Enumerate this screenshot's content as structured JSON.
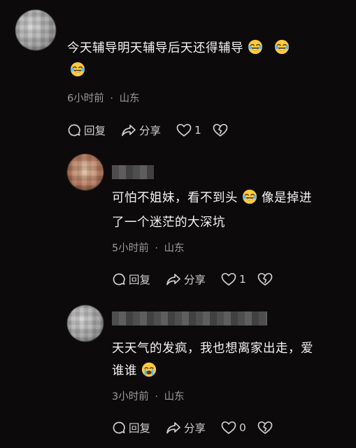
{
  "comments": [
    {
      "text_lines": [
        "今天辅导明天辅导后天还得辅导"
      ],
      "emoji_after_line1": 2,
      "extra_line_emojis": 1,
      "time": "6小时前",
      "location": "山东",
      "reply_label": "回复",
      "share_label": "分享",
      "likes": "1",
      "emoji_icon": "laughing-crying-emoji"
    },
    {
      "text_line1_a": "可怕不姐妹，看不到头",
      "text_line1_b": "像是掉进",
      "text_line2": "了一个迷茫的大深坑",
      "time": "5小时前",
      "location": "山东",
      "reply_label": "回复",
      "share_label": "分享",
      "likes": "1",
      "emoji_icon": "laughing-crying-emoji"
    },
    {
      "text_line1": "天天气的发疯，我也想离家出走，爱",
      "text_line2": "谁谁",
      "time": "3小时前",
      "location": "山东",
      "reply_label": "回复",
      "share_label": "分享",
      "likes": "0",
      "emoji_icon": "sobbing-emoji"
    }
  ],
  "separator": "·"
}
